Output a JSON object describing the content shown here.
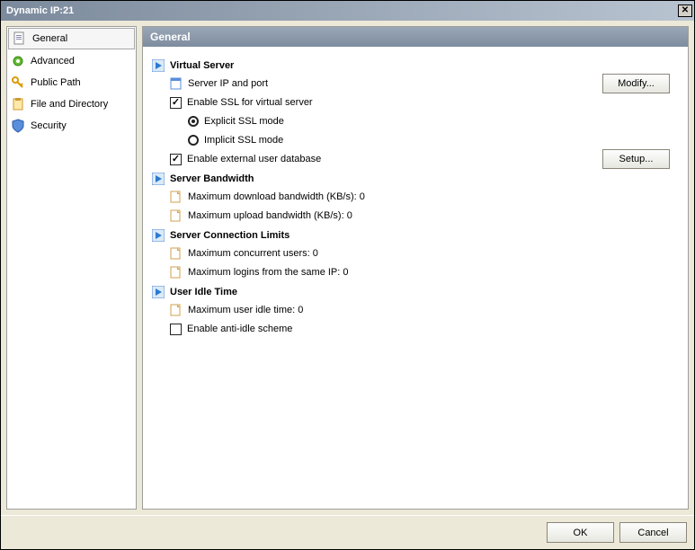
{
  "window": {
    "title": "Dynamic IP:21"
  },
  "sidebar": {
    "items": [
      {
        "label": "General"
      },
      {
        "label": "Advanced"
      },
      {
        "label": "Public Path"
      },
      {
        "label": "File and Directory"
      },
      {
        "label": "Security"
      }
    ]
  },
  "main": {
    "title": "General",
    "sections": {
      "virtual_server": {
        "heading": "Virtual Server",
        "server_ip_port": "Server IP and port",
        "enable_ssl": "Enable SSL for virtual server",
        "explicit_ssl": "Explicit SSL mode",
        "implicit_ssl": "Implicit SSL mode",
        "enable_ext_db": "Enable external user database",
        "modify_btn": "Modify...",
        "setup_btn": "Setup..."
      },
      "bandwidth": {
        "heading": "Server Bandwidth",
        "max_download": "Maximum download bandwidth (KB/s): 0",
        "max_upload": "Maximum upload bandwidth (KB/s): 0"
      },
      "conn_limits": {
        "heading": "Server Connection Limits",
        "max_concurrent": "Maximum concurrent users: 0",
        "max_same_ip": "Maximum logins from the same IP: 0"
      },
      "idle": {
        "heading": "User Idle Time",
        "max_idle": "Maximum user idle time: 0",
        "anti_idle": "Enable anti-idle scheme"
      }
    }
  },
  "footer": {
    "ok": "OK",
    "cancel": "Cancel"
  }
}
